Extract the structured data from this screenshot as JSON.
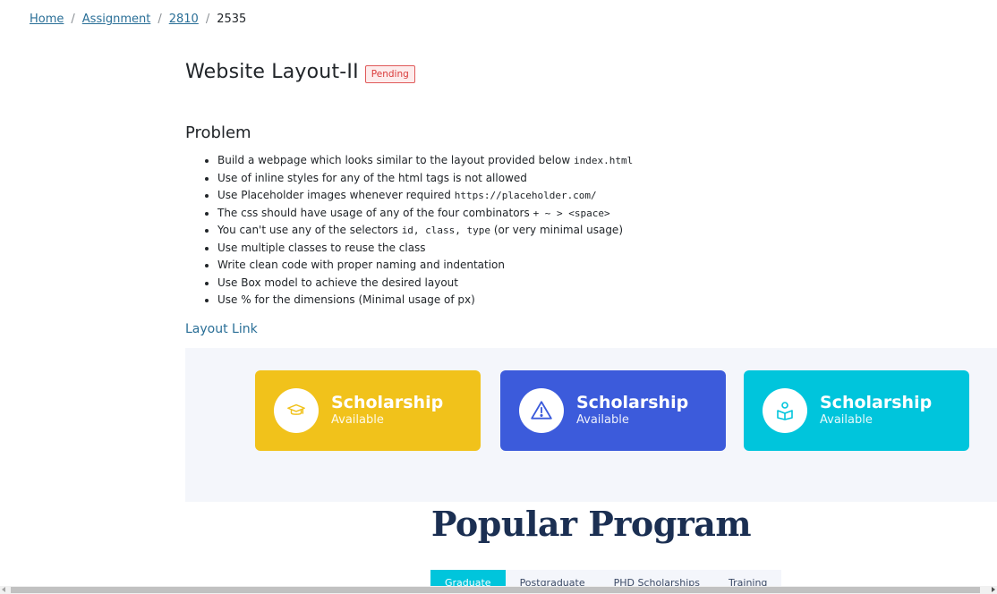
{
  "breadcrumb": {
    "items": [
      "Home",
      "Assignment",
      "2810"
    ],
    "current": "2535",
    "separator": "/"
  },
  "header": {
    "title": "Website Layout-II",
    "status": "Pending"
  },
  "problem": {
    "heading": "Problem",
    "items": [
      {
        "text": "Build a webpage which looks similar to the layout provided below ",
        "code": "index.html"
      },
      {
        "text": "Use of inline styles for any of the html tags is not allowed",
        "code": ""
      },
      {
        "text": "Use Placeholder images whenever required ",
        "code": "https://placeholder.com/"
      },
      {
        "text": "The css should have usage of any of the four combinators ",
        "code": "+ ~ > <space>"
      },
      {
        "text": "You can't use any of the selectors ",
        "code": "id, class, type",
        "suffix": " (or very minimal usage)"
      },
      {
        "text": "Use multiple classes to reuse the class",
        "code": ""
      },
      {
        "text": "Write clean code with proper naming and indentation",
        "code": ""
      },
      {
        "text": "Use Box model to achieve the desired layout",
        "code": ""
      },
      {
        "text": "Use % for the dimensions (Minimal usage of px)",
        "code": ""
      }
    ]
  },
  "layout_link": "Layout Link",
  "preview": {
    "cards": [
      {
        "title": "Scholarship",
        "subtitle": "Available",
        "icon": "graduation-cap-icon",
        "color": "#f1c21b"
      },
      {
        "title": "Scholarship",
        "subtitle": "Available",
        "icon": "warning-icon",
        "color": "#3c5bdb"
      },
      {
        "title": "Scholarship",
        "subtitle": "Available",
        "icon": "reading-person-icon",
        "color": "#00c5dc"
      }
    ],
    "popular_heading": "Popular Program",
    "tabs": [
      "Graduate",
      "Postgraduate",
      "PHD Scholarships",
      "Training"
    ],
    "active_tab": "Graduate"
  }
}
